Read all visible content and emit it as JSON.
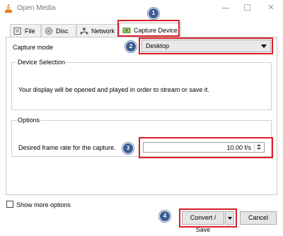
{
  "window": {
    "title": "Open Media",
    "controls": [
      "minimize",
      "maximize",
      "close"
    ],
    "close_glyph": "✕"
  },
  "tabs": [
    {
      "label": "File",
      "icon": "file-icon",
      "selected": false
    },
    {
      "label": "Disc",
      "icon": "disc-icon",
      "selected": false
    },
    {
      "label": "Network",
      "icon": "network-icon",
      "selected": false
    },
    {
      "label": "Capture Device",
      "icon": "capture-device-icon",
      "selected": true
    }
  ],
  "capture": {
    "mode_label": "Capture mode",
    "mode_value": "Desktop"
  },
  "device_selection": {
    "title": "Device Selection",
    "text": "Your display will be opened and played in order to stream or save it."
  },
  "options": {
    "title": "Options",
    "frame_rate_label": "Desired frame rate for the capture.",
    "frame_rate_value": "10.00 f/s"
  },
  "footer": {
    "show_more_label": "Show more options",
    "show_more_checked": false,
    "convert_label": "Convert / Save",
    "cancel_label": "Cancel"
  },
  "annotations": {
    "markers": [
      "1",
      "2",
      "3",
      "4"
    ],
    "highlight_color": "#d8202a",
    "marker_color": "#3c5c91"
  }
}
